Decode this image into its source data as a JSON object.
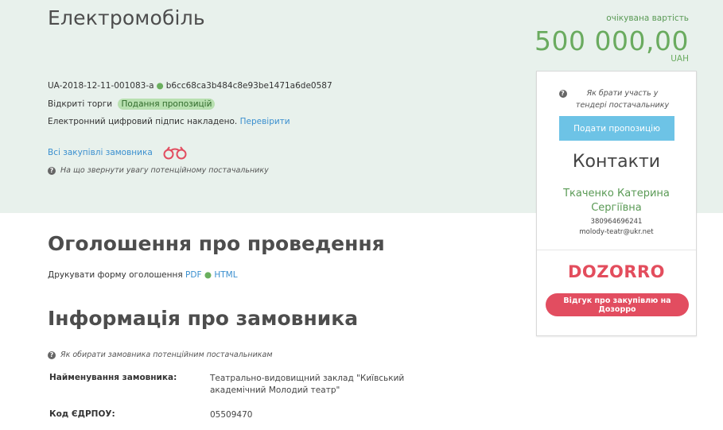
{
  "header": {
    "title": "Електромобіль",
    "tender_id": "UA-2018-12-11-001083-a",
    "tender_hash": "b6cc68ca3b484c8e93be1471a6de0587",
    "procedure": "Відкриті торги",
    "status_badge": "Подання пропозицій",
    "signature_text": "Електронний цифровий підпис накладено.",
    "signature_link": "Перевірити",
    "all_purchases_link": "Всі закупівлі замовника",
    "help_attention": "На що звернути увагу потенційному постачальнику"
  },
  "price": {
    "label": "очікувана вартість",
    "value": "500 000,00",
    "currency": "UAH"
  },
  "sidebar": {
    "help_text": "Як брати участь у тендері постачальнику",
    "submit_button": "Подати пропозицію",
    "contacts_title": "Контакти",
    "contact_name": "Ткаченко Катерина Сергіївна",
    "contact_phone": "380964696241",
    "contact_email": "molody-teatr@ukr.net",
    "dozorro_logo": "DOZORRO",
    "dozorro_button": "Відгук про закупівлю на Дозорро"
  },
  "announcement": {
    "title": "Оголошення про проведення",
    "print_text": "Друкувати форму оголошення",
    "pdf_link": "PDF",
    "html_link": "HTML"
  },
  "customer_info": {
    "title": "Інформація про замовника",
    "help_text": "Як обирати замовника потенційним постачальникам",
    "name_label": "Найменування замовника:",
    "name_value": "Театрально-видовищний заклад \"Київський академічний Молодий театр\"",
    "code_label": "Код ЄДРПОУ:",
    "code_value": "05509470"
  },
  "colors": {
    "band_bg": "#e8f1ec",
    "accent_green": "#6aab5f",
    "link_blue": "#3a8fcf",
    "submit_blue": "#6dc3e6",
    "dozorro_red": "#e24d60"
  }
}
